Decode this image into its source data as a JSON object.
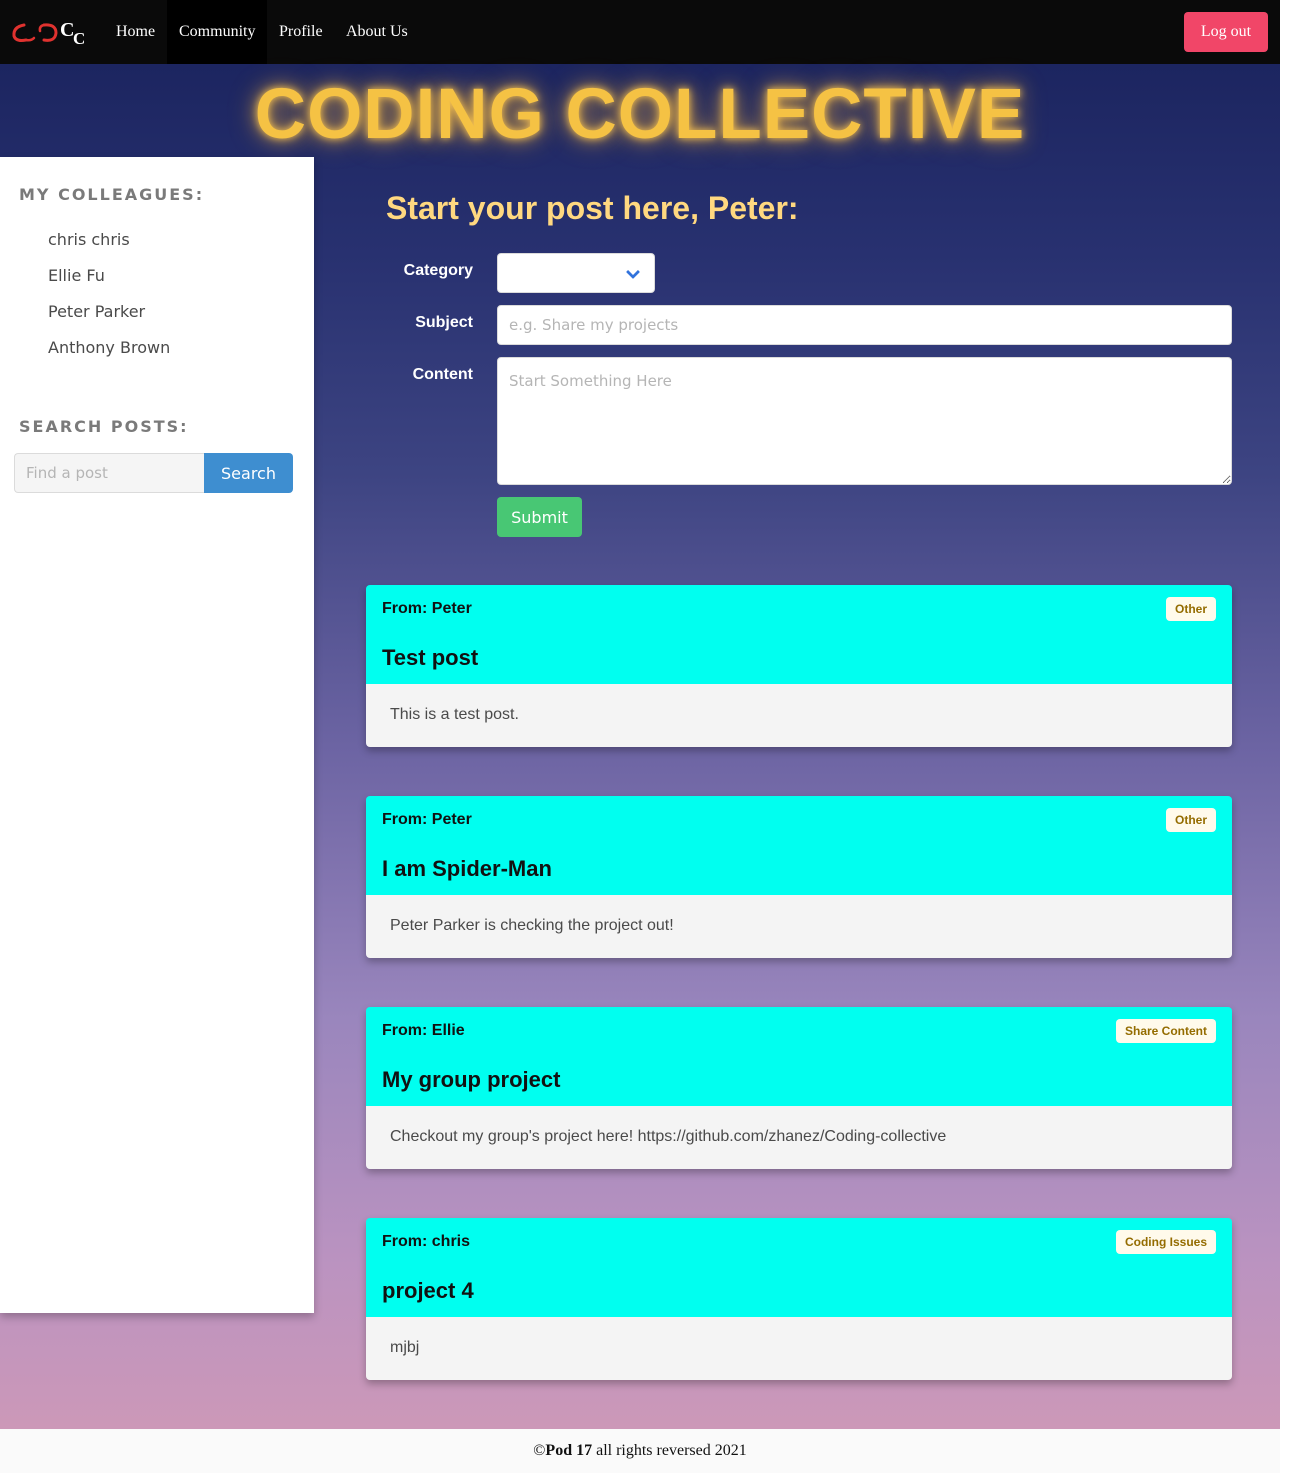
{
  "nav": {
    "logo_alt": "CC",
    "items": [
      "Home",
      "Community",
      "Profile",
      "About Us"
    ],
    "active_index": 1,
    "logout_label": "Log out",
    "logout_color": "#f14668"
  },
  "banner": {
    "title": "CODING COLLECTIVE",
    "color": "#f5c244"
  },
  "sidebar": {
    "colleagues_heading": "MY COLLEAGUES:",
    "colleagues": [
      "chris chris",
      "Ellie Fu",
      "Peter Parker",
      "Anthony Brown"
    ],
    "search_heading": "SEARCH POSTS:",
    "search_placeholder": "Find a post",
    "search_button": "Search"
  },
  "form": {
    "title": "Start your post here, Peter:",
    "category_label": "Category",
    "category_value": "",
    "subject_label": "Subject",
    "subject_placeholder": "e.g. Share my projects",
    "content_label": "Content",
    "content_placeholder": "Start Something Here",
    "submit_label": "Submit"
  },
  "posts": [
    {
      "from": "From: Peter",
      "tag": "Other",
      "title": "Test post",
      "body": "This is a test post."
    },
    {
      "from": "From: Peter",
      "tag": "Other",
      "title": "I am Spider-Man",
      "body": "Peter Parker is checking the project out!"
    },
    {
      "from": "From: Ellie",
      "tag": "Share Content",
      "title": "My group project",
      "body": "Checkout my group's project here! https://github.com/zhanez/Coding-collective"
    },
    {
      "from": "From: chris",
      "tag": "Coding Issues",
      "title": "project 4",
      "body": "mjbj"
    }
  ],
  "footer": {
    "prefix": "©",
    "bold": "Pod 17",
    "suffix": " all rights reversed 2021"
  },
  "colors": {
    "accent_cyan": "#00fff0",
    "submit_green": "#48c774",
    "search_blue": "#3e8ed0"
  }
}
